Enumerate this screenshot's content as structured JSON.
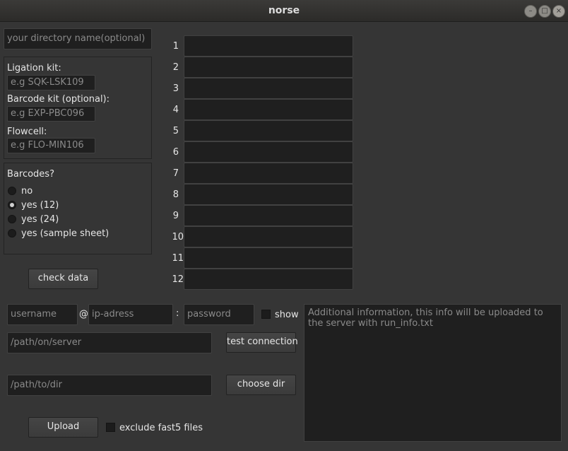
{
  "window": {
    "title": "norse",
    "controls": {
      "minimize": "–",
      "maximize": "□",
      "close": "×"
    }
  },
  "directory": {
    "placeholder": "your directory name(optional)"
  },
  "kits": {
    "ligation_label": "Ligation kit:",
    "ligation_placeholder": "e.g SQK-LSK109",
    "barcode_label": "Barcode kit (optional):",
    "barcode_placeholder": "e.g EXP-PBC096",
    "flowcell_label": "Flowcell:",
    "flowcell_placeholder": "e.g FLO-MIN106"
  },
  "barcodes": {
    "title": "Barcodes?",
    "options": [
      {
        "label": "no",
        "checked": false
      },
      {
        "label": "yes (12)",
        "checked": true
      },
      {
        "label": "yes (24)",
        "checked": false
      },
      {
        "label": "yes (sample sheet)",
        "checked": false
      }
    ]
  },
  "samples": {
    "rows": [
      "1",
      "2",
      "3",
      "4",
      "5",
      "6",
      "7",
      "8",
      "9",
      "10",
      "11",
      "12"
    ]
  },
  "check_button": "check data",
  "connection": {
    "username_placeholder": "username",
    "at": "@",
    "ip_placeholder": "ip-adress",
    "colon": ":",
    "password_placeholder": "password",
    "show_label": "show",
    "server_path_placeholder": "/path/on/server",
    "test_button": "test connection",
    "local_path_placeholder": "/path/to/dir",
    "choose_button": "choose dir"
  },
  "info": {
    "placeholder": "Additional information,  this info will be uploaded to the server with run_info.txt"
  },
  "upload": {
    "button": "Upload",
    "exclude_label": "exclude fast5 files"
  }
}
